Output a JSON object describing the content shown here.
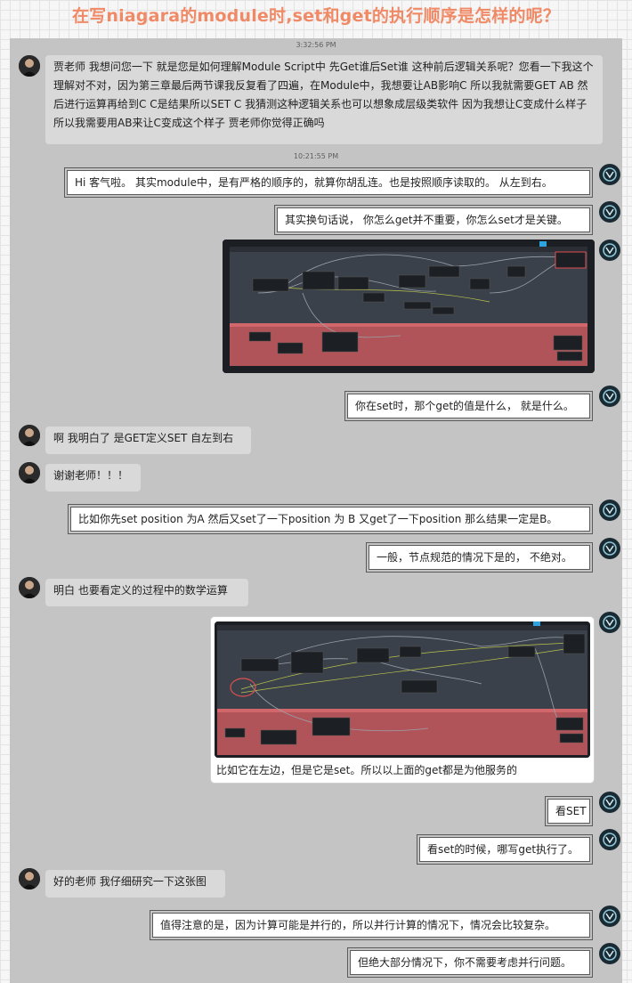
{
  "title": "在写niagara的module时,set和get的执行顺序是怎样的呢？",
  "timestamps": [
    "3:32:56 PM",
    "10:21:55 PM"
  ],
  "messages": {
    "m1": "贾老师 我想问您一下 就是您是如何理解Module Script中 先Get谁后Set谁 这种前后逻辑关系呢？您看一下我这个理解对不对，因为第三章最后两节课我反复看了四遍，在Module中，我想要让AB影响C 所以我就需要GET AB 然后进行运算再给到C C是结果所以SET C 我猜测这种逻辑关系也可以想象成层级类软件 因为我想让C变成什么样子 所以我需要用AB来让C变成这个样子 贾老师你觉得正确吗",
    "m2": "Hi 客气啦。 其实module中，是有严格的顺序的，就算你胡乱连。也是按照顺序读取的。 从左到右。",
    "m3": "其实换句话说， 你怎么get并不重要，你怎么set才是关键。",
    "m5": "你在set时，那个get的值是什么， 就是什么。",
    "m6": "啊 我明白了 是GET定义SET 自左到右",
    "m7": "谢谢老师！！！",
    "m8": "比如你先set position 为A 然后又set了一下position 为 B 又get了一下position 那么结果一定是B。",
    "m9": "一般，节点规范的情况下是的， 不绝对。",
    "m10": "明白 也要看定义的过程中的数学运算",
    "m11_caption": "比如它在左边，但是它是set。所以以上面的get都是为他服务的",
    "m12": "看SET",
    "m13": "看set的时候，哪写get执行了。",
    "m14": "好的老师 我仔细研究一下这张图",
    "m15": "值得注意的是，因为计算可能是并行的，所以并行计算的情况下，情况会比较复杂。",
    "m16": "但绝大部分情况下，你不需要考虑并行问题。"
  },
  "colors": {
    "title": "#f08a66",
    "chat_bg": "#c4c4c4",
    "left_bubble": "#d9d9d9",
    "right_bubble": "#ffffff",
    "graph_bg": "#3b414b",
    "graph_red_band": "#b0545a",
    "user_avatar": "#1a2a33"
  }
}
